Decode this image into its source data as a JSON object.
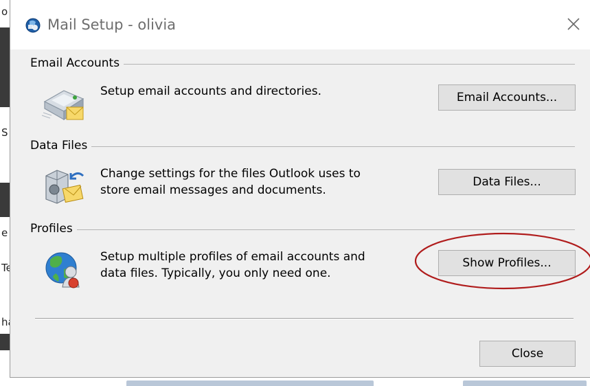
{
  "window": {
    "title": "Mail Setup - olivia"
  },
  "background": {
    "left_fragments": [
      "o",
      "S",
      "e",
      "Te",
      "ha"
    ]
  },
  "groups": {
    "email_accounts": {
      "label": "Email Accounts",
      "description": "Setup email accounts and directories.",
      "button": "Email Accounts..."
    },
    "data_files": {
      "label": "Data Files",
      "description_line1": "Change settings for the files Outlook uses to",
      "description_line2": "store email messages and documents.",
      "button": "Data Files..."
    },
    "profiles": {
      "label": "Profiles",
      "description_line1": "Setup multiple profiles of email accounts and",
      "description_line2": "data files. Typically, you only need one.",
      "button": "Show Profiles..."
    }
  },
  "footer": {
    "close_button": "Close"
  },
  "colors": {
    "dialog_bg": "#f0f0f0",
    "button_bg": "#e1e1e1",
    "button_border": "#adadad",
    "annotation": "#b01c1c"
  },
  "icons": {
    "app": "outlook-icon",
    "email_accounts": "email-accounts-icon",
    "data_files": "data-files-icon",
    "profiles": "profiles-icon",
    "close": "close-icon"
  }
}
